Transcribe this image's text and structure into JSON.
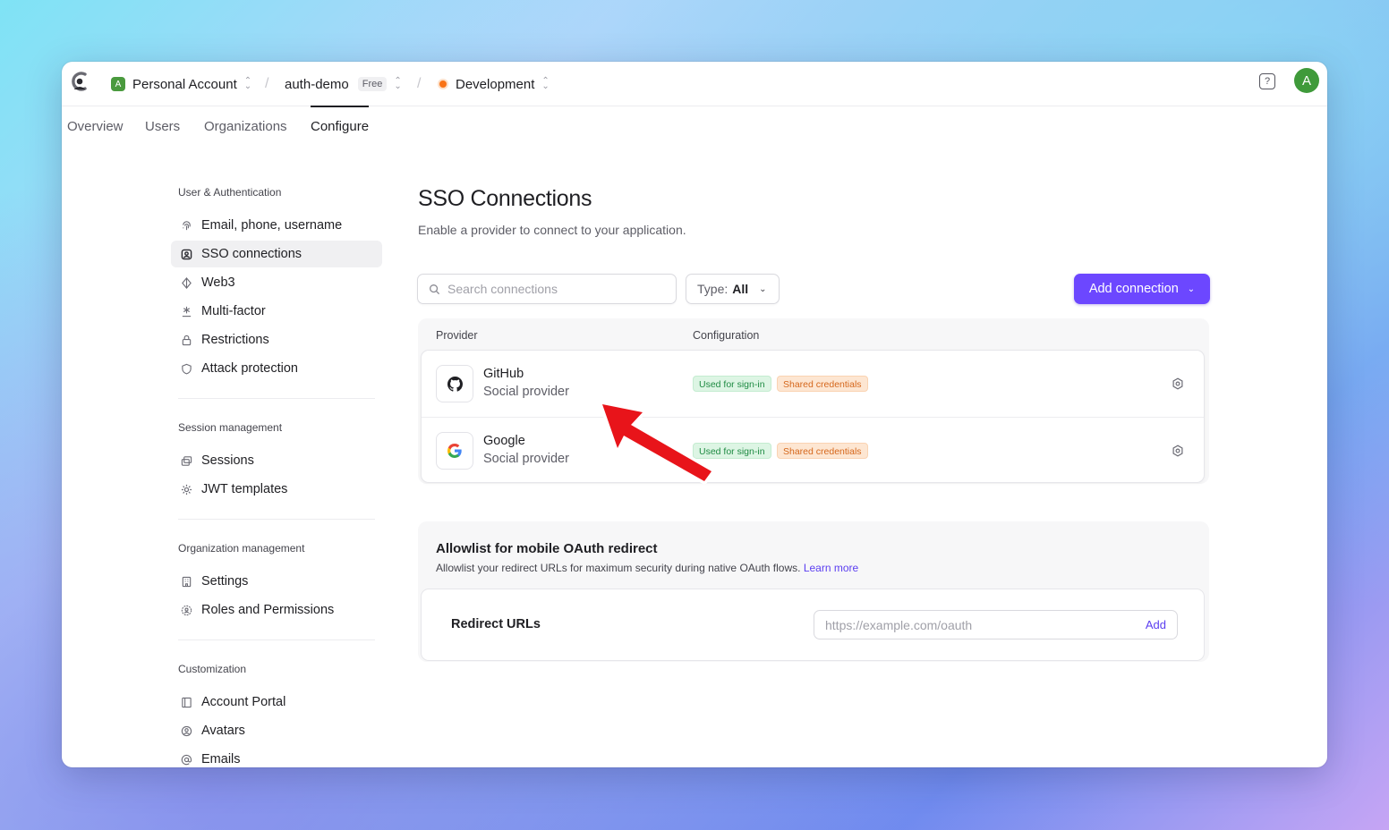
{
  "topbar": {
    "account_badge": "A",
    "account": "Personal Account",
    "app": "auth-demo",
    "plan": "Free",
    "environment": "Development",
    "help": "?",
    "avatar": "A"
  },
  "tabs": [
    "Overview",
    "Users",
    "Organizations",
    "Configure"
  ],
  "sidebar": {
    "groups": [
      {
        "title": "User & Authentication",
        "items": [
          {
            "label": "Email, phone, username",
            "icon": "fingerprint-icon"
          },
          {
            "label": "SSO connections",
            "icon": "sso-icon",
            "active": true
          },
          {
            "label": "Web3",
            "icon": "web3-icon"
          },
          {
            "label": "Multi-factor",
            "icon": "asterisk-icon"
          },
          {
            "label": "Restrictions",
            "icon": "lock-icon"
          },
          {
            "label": "Attack protection",
            "icon": "shield-icon"
          }
        ]
      },
      {
        "title": "Session management",
        "items": [
          {
            "label": "Sessions",
            "icon": "sessions-icon"
          },
          {
            "label": "JWT templates",
            "icon": "jwt-icon"
          }
        ]
      },
      {
        "title": "Organization management",
        "items": [
          {
            "label": "Settings",
            "icon": "building-icon"
          },
          {
            "label": "Roles and Permissions",
            "icon": "roles-icon"
          }
        ]
      },
      {
        "title": "Customization",
        "items": [
          {
            "label": "Account Portal",
            "icon": "portal-icon"
          },
          {
            "label": "Avatars",
            "icon": "avatar-icon"
          },
          {
            "label": "Emails",
            "icon": "at-icon"
          }
        ]
      }
    ]
  },
  "main": {
    "title": "SSO Connections",
    "subtitle": "Enable a provider to connect to your application.",
    "search_placeholder": "Search connections",
    "type_label": "Type:",
    "type_value": "All",
    "add_button": "Add connection",
    "table": {
      "headers": [
        "Provider",
        "Configuration"
      ],
      "rows": [
        {
          "name": "GitHub",
          "type": "Social provider",
          "icon": "github-icon",
          "tags": [
            "Used for sign-in",
            "Shared credentials"
          ]
        },
        {
          "name": "Google",
          "type": "Social provider",
          "icon": "google-icon",
          "tags": [
            "Used for sign-in",
            "Shared credentials"
          ]
        }
      ]
    },
    "allowlist": {
      "title": "Allowlist for mobile OAuth redirect",
      "description": "Allowlist your redirect URLs for maximum security during native OAuth flows.",
      "learn_more": "Learn more",
      "label": "Redirect URLs",
      "placeholder": "https://example.com/oauth",
      "add": "Add"
    }
  },
  "colors": {
    "accent": "#6c47ff",
    "annotation_arrow": "#e8141a"
  }
}
